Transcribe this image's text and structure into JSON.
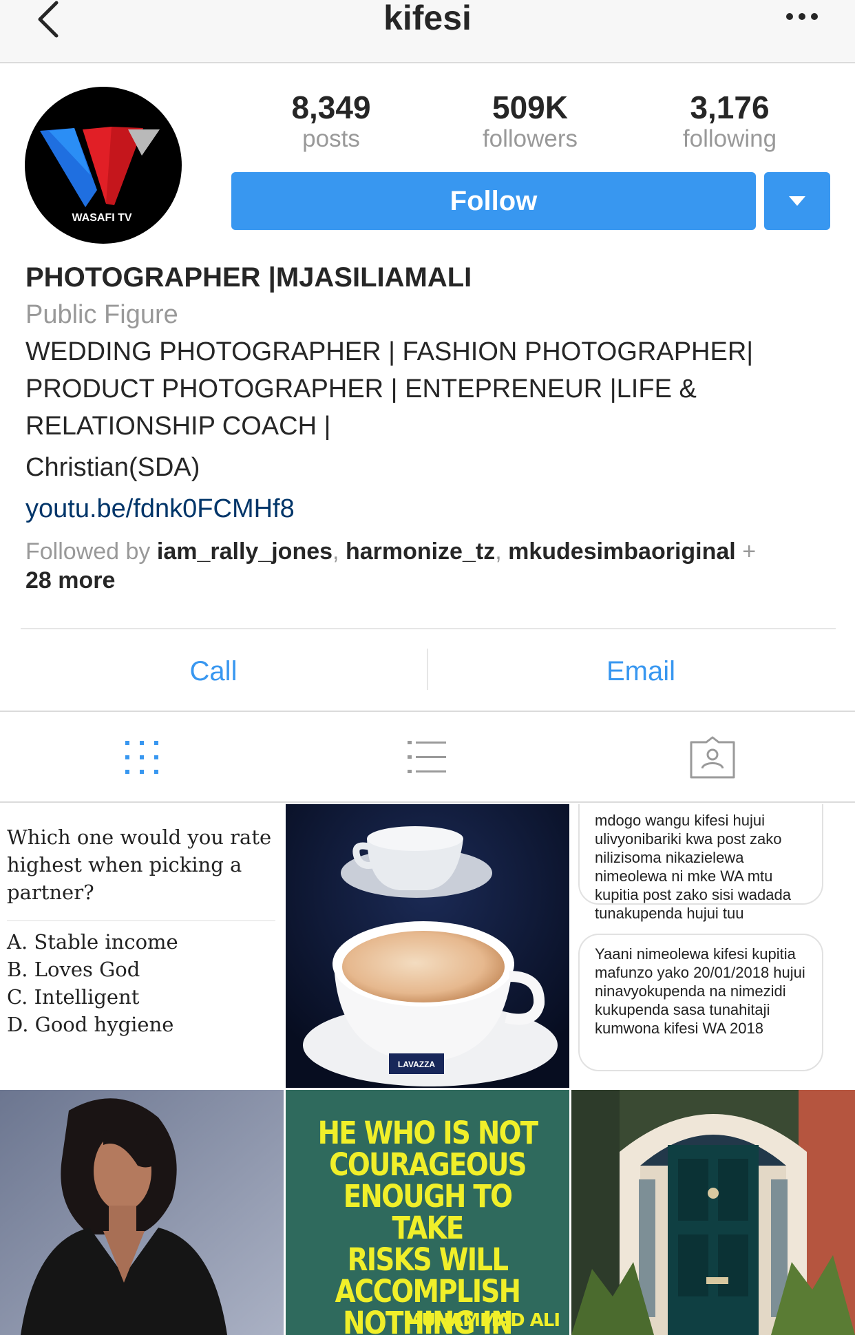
{
  "nav": {
    "title": "kifesi"
  },
  "profile": {
    "avatar_text": "WASAFI TV",
    "stats": {
      "posts": {
        "value": "8,349",
        "label": "posts"
      },
      "followers": {
        "value": "509K",
        "label": "followers"
      },
      "following": {
        "value": "3,176",
        "label": "following"
      }
    },
    "follow_label": "Follow"
  },
  "bio": {
    "name": "PHOTOGRAPHER |MJASILIAMALI",
    "category": "Public Figure",
    "line1": "WEDDING PHOTOGRAPHER | FASHION PHOTOGRAPHER|",
    "line2": "PRODUCT PHOTOGRAPHER | ENTEPRENEUR |LIFE &",
    "line3": "RELATIONSHIP COACH |",
    "line4": "Christian(SDA)",
    "link": "youtu.be/fdnk0FCMHf8",
    "followed_by_prefix": "Followed by ",
    "followers": [
      "iam_rally_jones",
      "harmonize_tz",
      "mkudesimbaoriginal"
    ],
    "followed_by_more": "28 more"
  },
  "contact": {
    "call": "Call",
    "email": "Email"
  },
  "tabs": [
    "grid-icon",
    "list-icon",
    "tagged-icon"
  ],
  "grid": {
    "quiz": {
      "question": "Which one would you rate highest when picking a partner?",
      "options": [
        "A. Stable income",
        "B. Loves God",
        "C. Intelligent",
        "D. Good hygiene"
      ]
    },
    "cup_brand": "LAVAZZA",
    "bubble1": "mdogo wangu kifesi hujui ulivyonibariki kwa post zako nilizisoma nikazielewa nimeolewa ni mke WA mtu kupitia post zako sisi wadada tunakupenda hujui tuu",
    "bubble2": "Yaani nimeolewa kifesi kupitia mafunzo yako 20/01/2018 hujui ninavyokupenda na nimezidi kukupenda sasa tunahitaji kumwona kifesi WA 2018",
    "quote_lines": [
      "HE WHO IS NOT",
      "COURAGEOUS",
      "ENOUGH TO TAKE",
      "RISKS WILL",
      "ACCOMPLISH",
      "NOTHING IN LIFE."
    ],
    "quote_author": "MUHAMMAD ALI"
  },
  "colors": {
    "accent": "#3897f0",
    "link": "#003569",
    "muted": "#999999"
  }
}
